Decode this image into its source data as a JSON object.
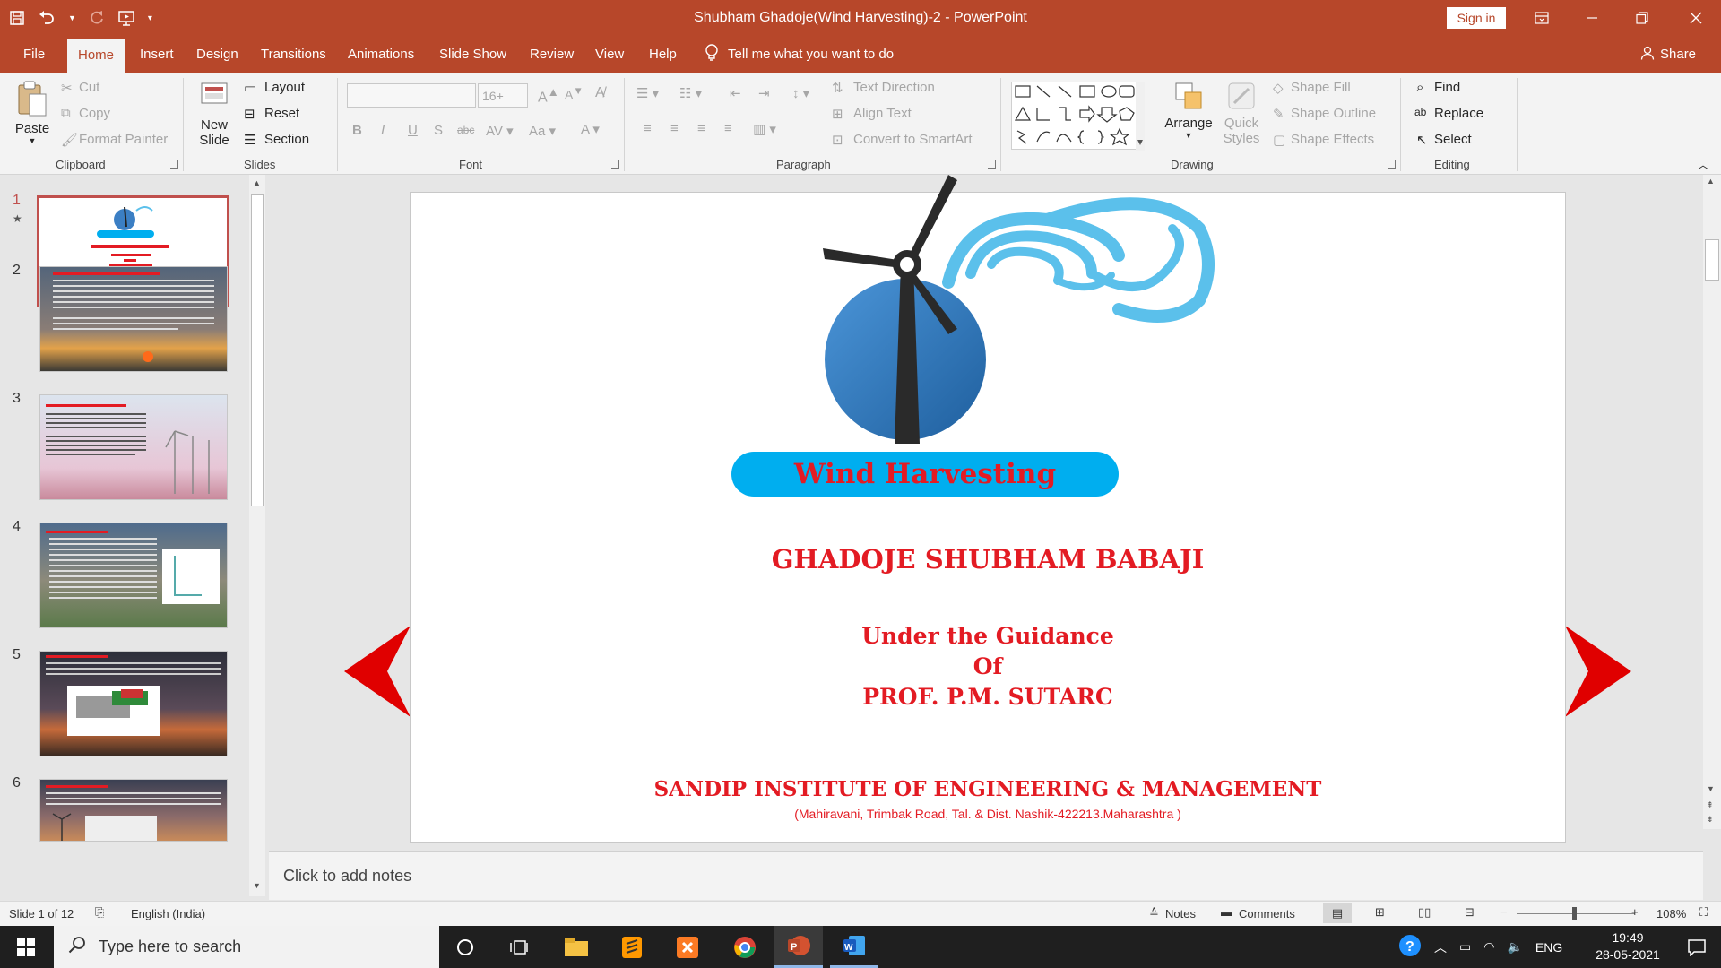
{
  "window": {
    "title": "Shubham Ghadoje(Wind Harvesting)-2  -  PowerPoint",
    "sign_in": "Sign in"
  },
  "tabs": [
    "File",
    "Home",
    "Insert",
    "Design",
    "Transitions",
    "Animations",
    "Slide Show",
    "Review",
    "View",
    "Help"
  ],
  "tell_me": "Tell me what you want to do",
  "share": "Share",
  "ribbon": {
    "clipboard": {
      "label": "Clipboard",
      "paste": "Paste",
      "cut": "Cut",
      "copy": "Copy",
      "format_painter": "Format Painter"
    },
    "slides": {
      "label": "Slides",
      "new_slide_line1": "New",
      "new_slide_line2": "Slide",
      "layout": "Layout",
      "reset": "Reset",
      "section": "Section"
    },
    "font": {
      "label": "Font",
      "size": "16+"
    },
    "paragraph": {
      "label": "Paragraph",
      "text_direction": "Text Direction",
      "align_text": "Align Text",
      "convert_smartart": "Convert to SmartArt"
    },
    "drawing": {
      "label": "Drawing",
      "arrange": "Arrange",
      "quick_styles_1": "Quick",
      "quick_styles_2": "Styles",
      "shape_fill": "Shape Fill",
      "shape_outline": "Shape Outline",
      "shape_effects": "Shape Effects"
    },
    "editing": {
      "label": "Editing",
      "find": "Find",
      "replace": "Replace",
      "select": "Select"
    }
  },
  "thumbnails": [
    "1",
    "2",
    "3",
    "4",
    "5",
    "6"
  ],
  "slide": {
    "banner": "Wind Harvesting",
    "author": "GHADOJE SHUBHAM BABAJI",
    "guidance_1": "Under the Guidance",
    "guidance_2": "Of",
    "guidance_3": "PROF. P.M. SUTARC",
    "institute": "SANDIP INSTITUTE OF ENGINEERING & MANAGEMENT",
    "address": "(Mahiravani, Trimbak Road, Tal. & Dist. Nashik-422213.Maharashtra  )"
  },
  "notes_placeholder": "Click to add notes",
  "status": {
    "slide_count": "Slide 1 of 12",
    "language": "English (India)",
    "notes": "Notes",
    "comments": "Comments",
    "zoom": "108%"
  },
  "taskbar": {
    "search_placeholder": "Type here to search",
    "lang": "ENG",
    "time": "19:49",
    "date": "28-05-2021"
  },
  "colors": {
    "accent": "#b7472a",
    "slide_red": "#e31b23",
    "banner_blue": "#00aeef"
  }
}
